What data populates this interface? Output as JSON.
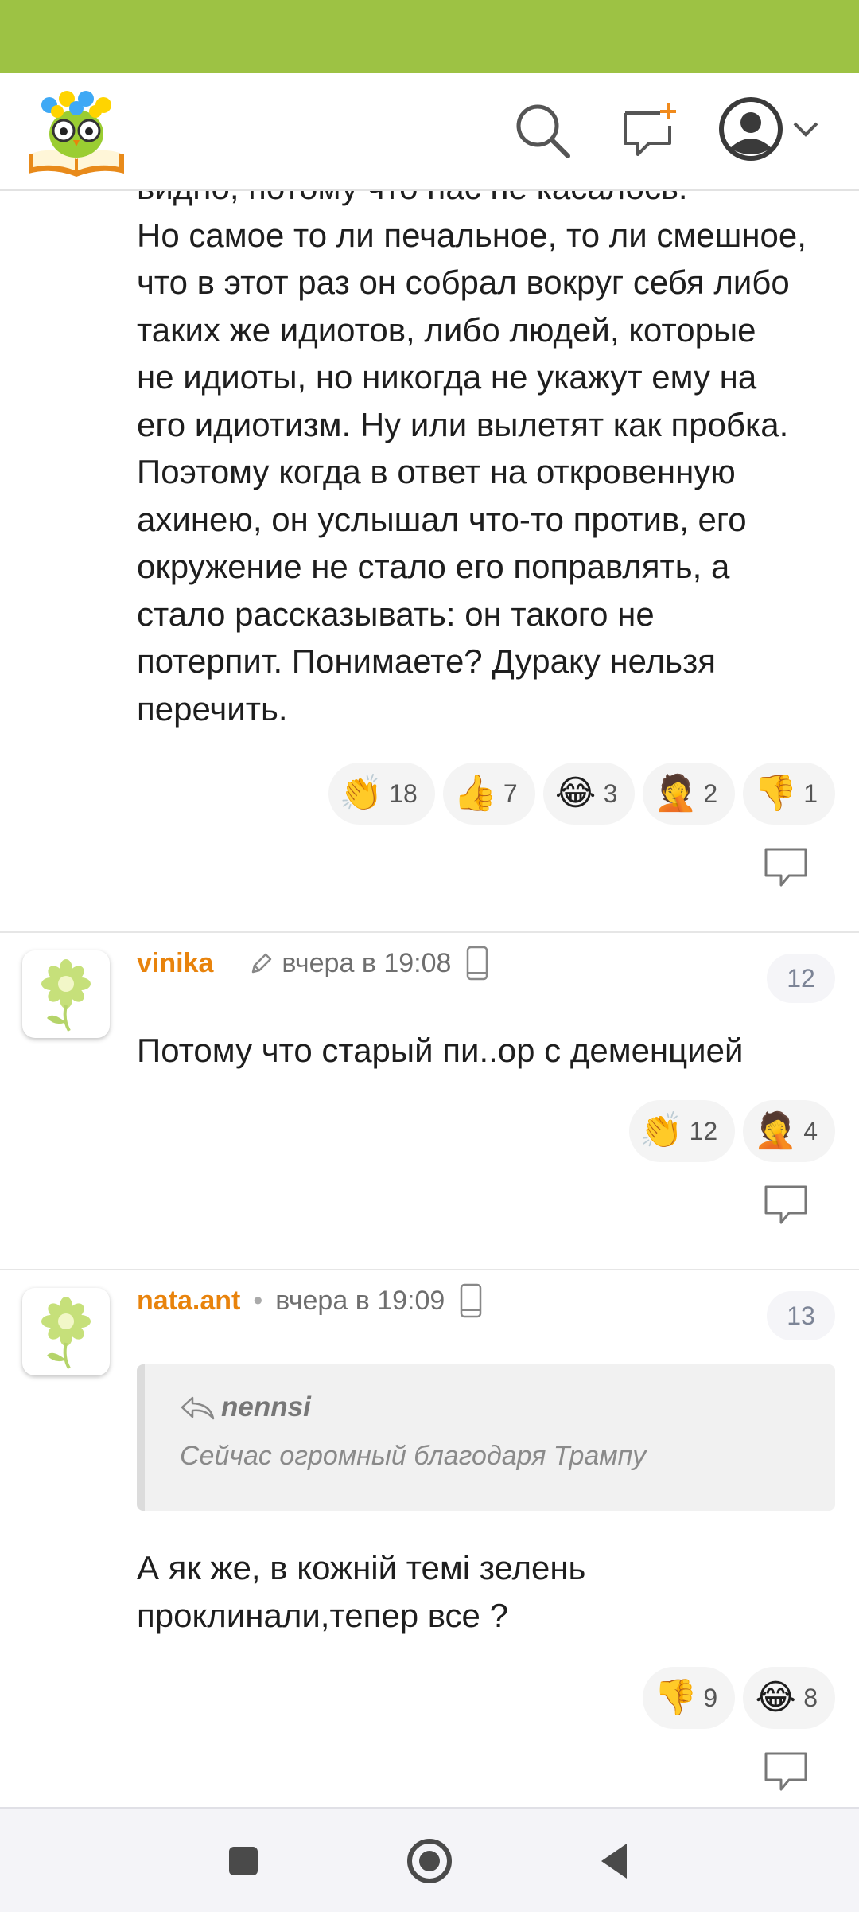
{
  "header": {
    "logo_icon": "owl-on-book-logo",
    "search_icon": "search-icon",
    "new_post_icon": "add-comment-icon",
    "avatar_icon": "user-avatar-icon",
    "menu_icon": "chevron-down-icon"
  },
  "comment1": {
    "partial_line": "видно, потому что нас не касалось.",
    "lines": [
      "Но самое то ли печальное, то ли смешное,",
      "что в этот раз он собрал вокруг себя либо",
      "таких же идиотов, либо людей, которые",
      "не идиоты, но никогда не укажут ему на",
      "его идиотизм. Ну или вылетят как пробка.",
      "Поэтому когда в ответ на откровенную",
      "ахинею, он услышал что-то против, его",
      "окружение не стало его поправлять, а",
      "стало рассказывать: он такого не",
      "потерпит. Понимаете? Дураку нельзя",
      "перечить."
    ],
    "reactions": [
      {
        "emoji": "👏",
        "count": "18"
      },
      {
        "emoji": "👍",
        "count": "7"
      },
      {
        "emoji": "😂",
        "count": "3"
      },
      {
        "emoji": "🤦",
        "count": "2"
      },
      {
        "emoji": "👎",
        "count": "1"
      }
    ]
  },
  "comment2": {
    "author": "vinika",
    "time": "вчера в 19:08",
    "number": "12",
    "text": "Потому что старый пи..ор с деменцией",
    "reactions": [
      {
        "emoji": "👏",
        "count": "12"
      },
      {
        "emoji": "🤦",
        "count": "4"
      }
    ]
  },
  "comment3": {
    "author": "nata.ant",
    "separator": "•",
    "time": "вчера в 19:09",
    "number": "13",
    "quote": {
      "author": "nennsi",
      "text": "Сейчас огромный благодаря Трампу"
    },
    "lines": [
      "А як же, в кожній темі зелень",
      "проклинали,тепер все ?"
    ],
    "reactions": [
      {
        "emoji": "👎",
        "count": "9"
      },
      {
        "emoji": "😂",
        "count": "8"
      }
    ]
  },
  "colors": {
    "status_bar": "#9dc244",
    "author": "#e8830c",
    "reaction_bg": "#f4f4f4"
  }
}
